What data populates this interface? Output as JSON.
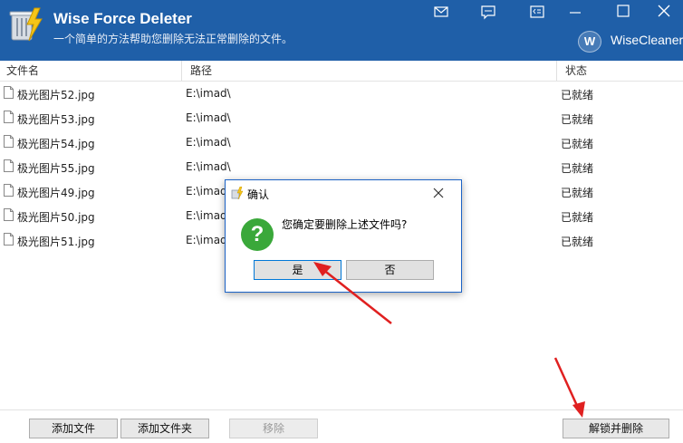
{
  "titlebar": {
    "app_title": "Wise Force Deleter",
    "subtitle": "一个简单的方法帮助您删除无法正常删除的文件。",
    "brand": "WiseCleaner",
    "brand_initial": "W",
    "bg_color": "#1f5fa8"
  },
  "columns": [
    "文件名",
    "路径",
    "状态"
  ],
  "files": [
    {
      "name": "极光图片52.jpg",
      "path": "E:\\imad\\",
      "status": "已就绪"
    },
    {
      "name": "极光图片53.jpg",
      "path": "E:\\imad\\",
      "status": "已就绪"
    },
    {
      "name": "极光图片54.jpg",
      "path": "E:\\imad\\",
      "status": "已就绪"
    },
    {
      "name": "极光图片55.jpg",
      "path": "E:\\imad\\",
      "status": "已就绪"
    },
    {
      "name": "极光图片49.jpg",
      "path": "E:\\imad\\",
      "status": "已就绪"
    },
    {
      "name": "极光图片50.jpg",
      "path": "E:\\imad\\",
      "status": "已就绪"
    },
    {
      "name": "极光图片51.jpg",
      "path": "E:\\imad\\",
      "status": "已就绪"
    }
  ],
  "toolbar": {
    "add_file": "添加文件",
    "add_folder": "添加文件夹",
    "remove": "移除",
    "unlock_delete": "解锁并删除"
  },
  "dialog": {
    "title": "确认",
    "message": "您确定要删除上述文件吗?",
    "yes": "是",
    "no": "否",
    "icon": "question-icon"
  },
  "annotation_color": "#e02020"
}
